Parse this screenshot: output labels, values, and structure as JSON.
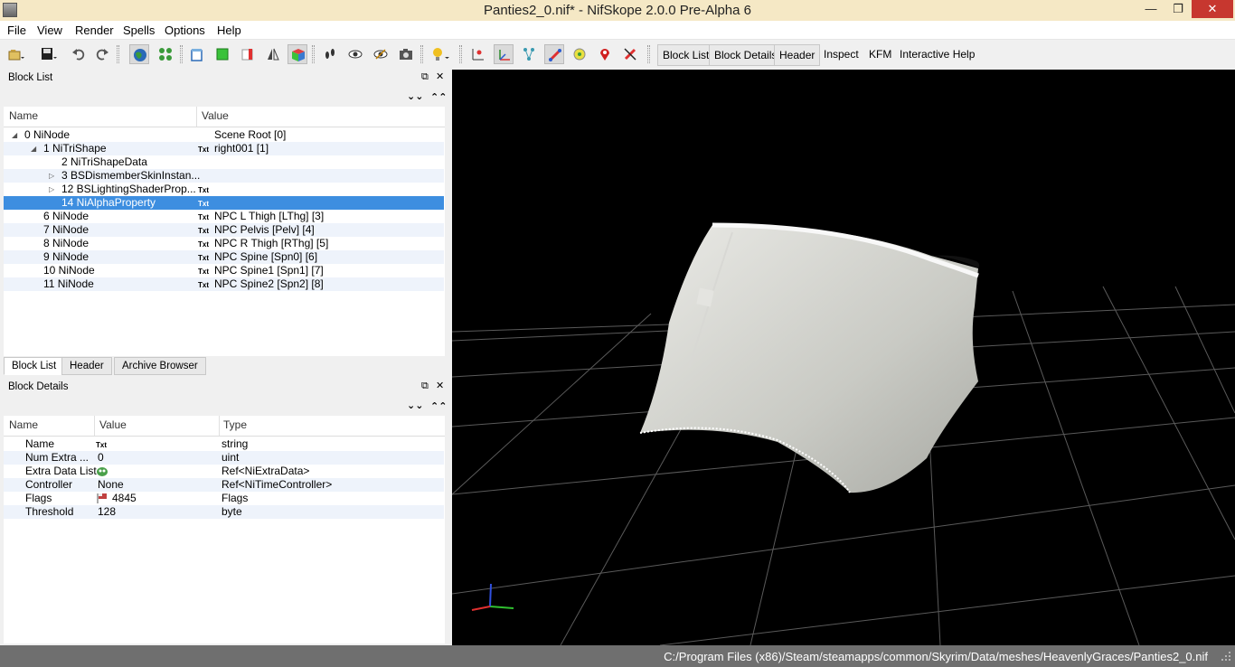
{
  "window": {
    "title": "Panties2_0.nif* - NifSkope 2.0.0 Pre-Alpha 6",
    "minimize": "—",
    "maximize": "❐",
    "close": "✕"
  },
  "menu": [
    "File",
    "View",
    "Render",
    "Spells",
    "Options",
    "Help"
  ],
  "toolbar": {
    "text_buttons": [
      "Block List",
      "Block Details",
      "Header",
      "Inspect",
      "KFM",
      "Interactive Help"
    ]
  },
  "block_list": {
    "title": "Block List",
    "columns": [
      "Name",
      "Value"
    ],
    "rows": [
      {
        "name": "0 NiNode",
        "txt": "",
        "value": "Scene Root [0]"
      },
      {
        "name": "1 NiTriShape",
        "txt": "Txt",
        "value": "right001 [1]"
      },
      {
        "name": "2 NiTriShapeData",
        "txt": "",
        "value": ""
      },
      {
        "name": "3 BSDismemberSkinInstan...",
        "txt": "",
        "value": ""
      },
      {
        "name": "12 BSLightingShaderProp...",
        "txt": "Txt",
        "value": ""
      },
      {
        "name": "14 NiAlphaProperty",
        "txt": "Txt",
        "value": ""
      },
      {
        "name": "6 NiNode",
        "txt": "Txt",
        "value": "NPC L Thigh [LThg] [3]"
      },
      {
        "name": "7 NiNode",
        "txt": "Txt",
        "value": "NPC Pelvis [Pelv] [4]"
      },
      {
        "name": "8 NiNode",
        "txt": "Txt",
        "value": "NPC R Thigh [RThg] [5]"
      },
      {
        "name": "9 NiNode",
        "txt": "Txt",
        "value": "NPC Spine [Spn0] [6]"
      },
      {
        "name": "10 NiNode",
        "txt": "Txt",
        "value": "NPC Spine1 [Spn1] [7]"
      },
      {
        "name": "11 NiNode",
        "txt": "Txt",
        "value": "NPC Spine2 [Spn2] [8]"
      }
    ]
  },
  "tabs": [
    "Block List",
    "Header",
    "Archive Browser"
  ],
  "block_details": {
    "title": "Block Details",
    "columns": [
      "Name",
      "Value",
      "Type"
    ],
    "rows": [
      {
        "name": "Name",
        "value": "Txt",
        "type": "string"
      },
      {
        "name": "Num Extra ...",
        "value": "0",
        "type": "uint"
      },
      {
        "name": "Extra Data List",
        "value": "",
        "type": "Ref<NiExtraData>"
      },
      {
        "name": "Controller",
        "value": "None",
        "type": "Ref<NiTimeController>"
      },
      {
        "name": "Flags",
        "value": "4845",
        "type": "Flags"
      },
      {
        "name": "Threshold",
        "value": "128",
        "type": "byte"
      }
    ]
  },
  "status": {
    "path": "C:/Program Files (x86)/Steam/steamapps/common/Skyrim/Data/meshes/HeavenlyGraces/Panties2_0.nif"
  }
}
